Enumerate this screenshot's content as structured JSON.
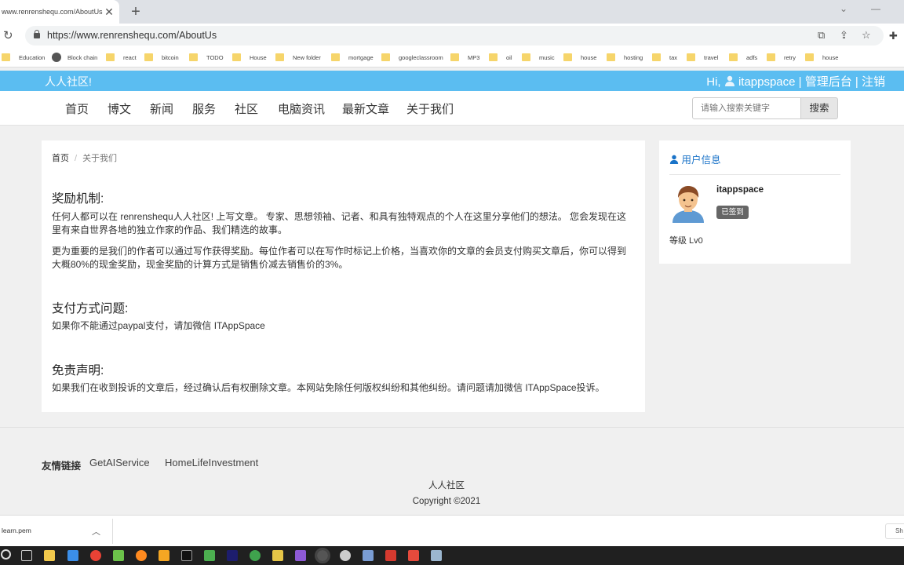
{
  "browser": {
    "tab_title": "www.renrenshequ.com/AboutUs",
    "url": "https://www.renrenshequ.com/AboutUs",
    "bookmarks": [
      "Education",
      "Block chain",
      "react",
      "bitcoin",
      "TODO",
      "House",
      "New folder",
      "mortgage",
      "googleclassroom",
      "MP3",
      "oil",
      "music",
      "house",
      "hosting",
      "tax",
      "travel",
      "adfs",
      "retry",
      "house"
    ]
  },
  "site": {
    "logo": "人人社区!",
    "greeting": "Hi,",
    "username": "itappspace",
    "admin_link": "| 管理后台 |",
    "logout_link": "注销",
    "nav": [
      "首页",
      "博文",
      "新闻",
      "服务",
      "社区",
      "电脑资讯",
      "最新文章",
      "关于我们"
    ],
    "search_placeholder": "请输入搜索关键字",
    "search_button": "搜索"
  },
  "main": {
    "breadcrumb": {
      "home": "首页",
      "sep": "/",
      "current": "关于我们"
    },
    "sections": [
      {
        "heading": "奖励机制:",
        "paragraphs": [
          "任何人都可以在 renrenshequ人人社区! 上写文章。 专家、思想领袖、记者、和具有独特观点的个人在这里分享他们的想法。 您会发现在这里有来自世界各地的独立作家的作品、我们精选的故事。",
          "更为重要的是我们的作者可以通过写作获得奖励。每位作者可以在写作时标记上价格，当喜欢你的文章的会员支付购买文章后，你可以得到大概80%的现金奖励，现金奖励的计算方式是销售价减去销售价的3%。"
        ]
      },
      {
        "heading": "支付方式问题:",
        "paragraphs": [
          "如果你不能通过paypal支付，请加微信 ITAppSpace"
        ]
      },
      {
        "heading": "免责声明:",
        "paragraphs": [
          "如果我们在收到投诉的文章后，经过确认后有权删除文章。本网站免除任何版权纠纷和其他纠纷。请问题请加微信 ITAppSpace投诉。"
        ]
      }
    ]
  },
  "sidebar": {
    "title": "用户信息",
    "username": "itappspace",
    "signed_badge": "已签到",
    "level": "等级 Lv0"
  },
  "footer": {
    "links_title": "友情链接",
    "links": [
      "GetAIService",
      "HomeLifeInvestment"
    ],
    "brand": "人人社区",
    "copyright": "Copyright ©2021"
  },
  "downloads": {
    "file": "learn.pem",
    "show_all": "Sh"
  },
  "colors": {
    "site_header": "#5bbdf1",
    "link_blue": "#1a73c8",
    "badge_gray": "#666666"
  }
}
